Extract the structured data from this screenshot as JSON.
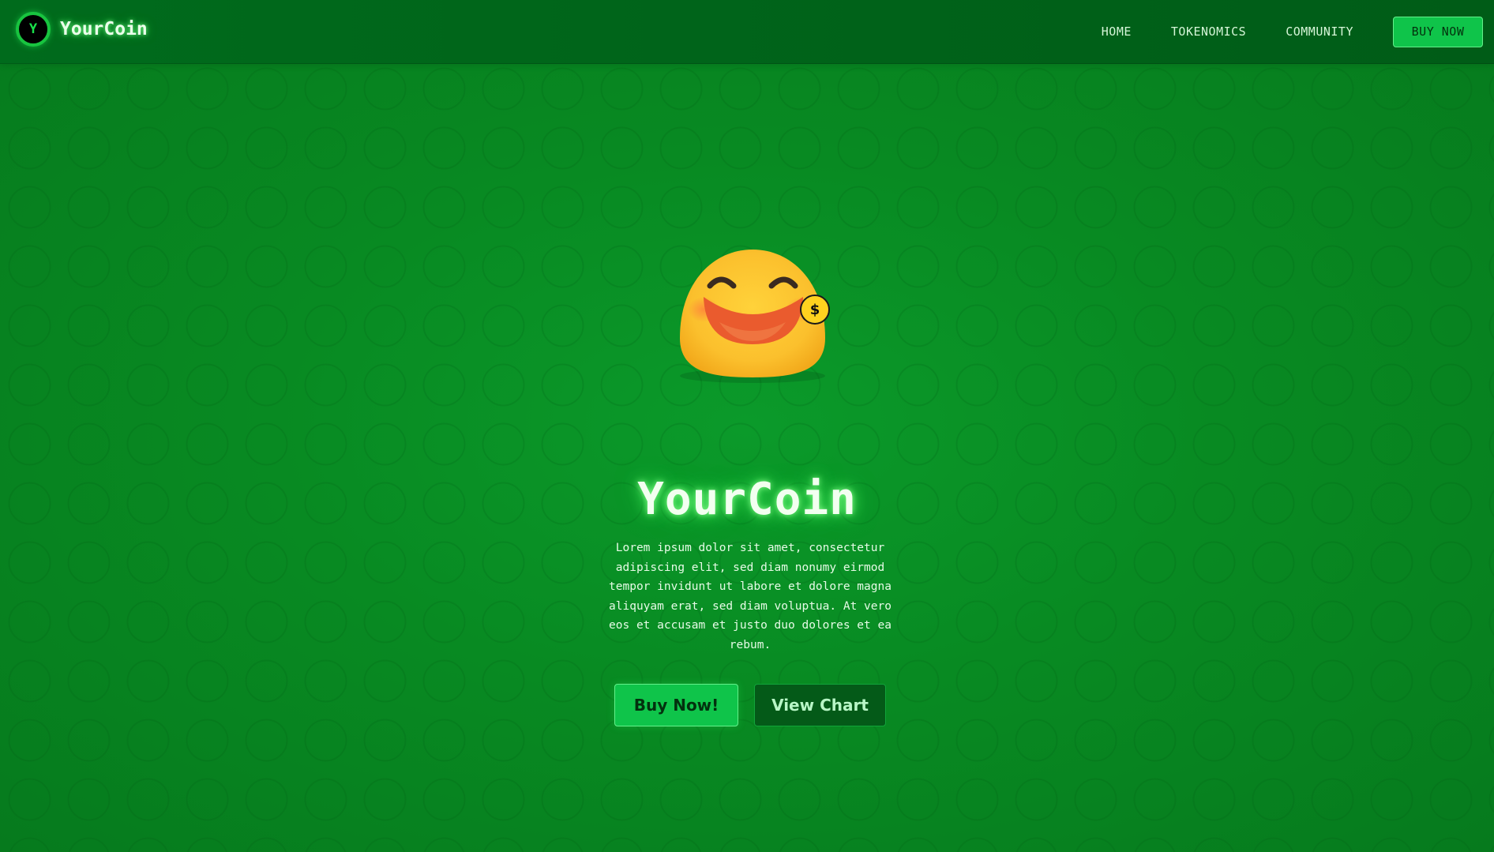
{
  "brand": {
    "logo_letter": "Y",
    "name": "YourCoin"
  },
  "nav": {
    "links": [
      "HOME",
      "TOKENOMICS",
      "COMMUNITY"
    ],
    "buy_label": "BUY NOW"
  },
  "hero": {
    "mascot_icon": "smiling-emoji",
    "coin_symbol": "$",
    "title": "YourCoin",
    "description": "Lorem ipsum dolor sit amet, consectetur adipiscing elit, sed diam nonumy eirmod tempor invidunt ut labore et dolore magna aliquyam erat, sed diam voluptua. At vero eos et accusam et justo duo dolores et ea rebum.",
    "primary_button": "Buy Now!",
    "secondary_button": "View Chart"
  },
  "colors": {
    "background": "#0a8a22",
    "header": "#006b1c",
    "accent": "#0fc44a",
    "glow": "#4dff6e",
    "coin_gold": "#ffd21f",
    "secondary_button": "#045a18"
  }
}
